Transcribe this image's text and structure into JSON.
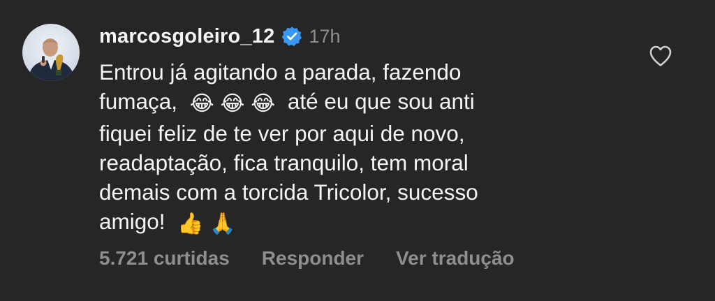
{
  "comment": {
    "username": "marcosgoleiro_12",
    "verified": true,
    "timestamp": "17h",
    "lines": [
      "Entrou já agitando a parada, fazendo",
      "fumaça,",
      "até eu que sou anti",
      "fiquei feliz de te ver por aqui de novo,",
      "readaptação, fica tranquilo, tem moral",
      "demais com a torcida Tricolor, sucesso",
      "amigo!"
    ],
    "emojis": {
      "laughing": "😂",
      "thumbs_up": "👍",
      "pray": "🙏"
    },
    "likes_text": "5.721 curtidas",
    "reply_label": "Responder",
    "translate_label": "Ver tradução"
  },
  "icons": {
    "heart": "heart-icon",
    "verified": "verified-badge-icon",
    "avatar": "avatar"
  },
  "colors": {
    "background": "#262626",
    "text": "#f5f5f5",
    "muted": "#8e8e8e",
    "verified_blue": "#3897f0"
  }
}
